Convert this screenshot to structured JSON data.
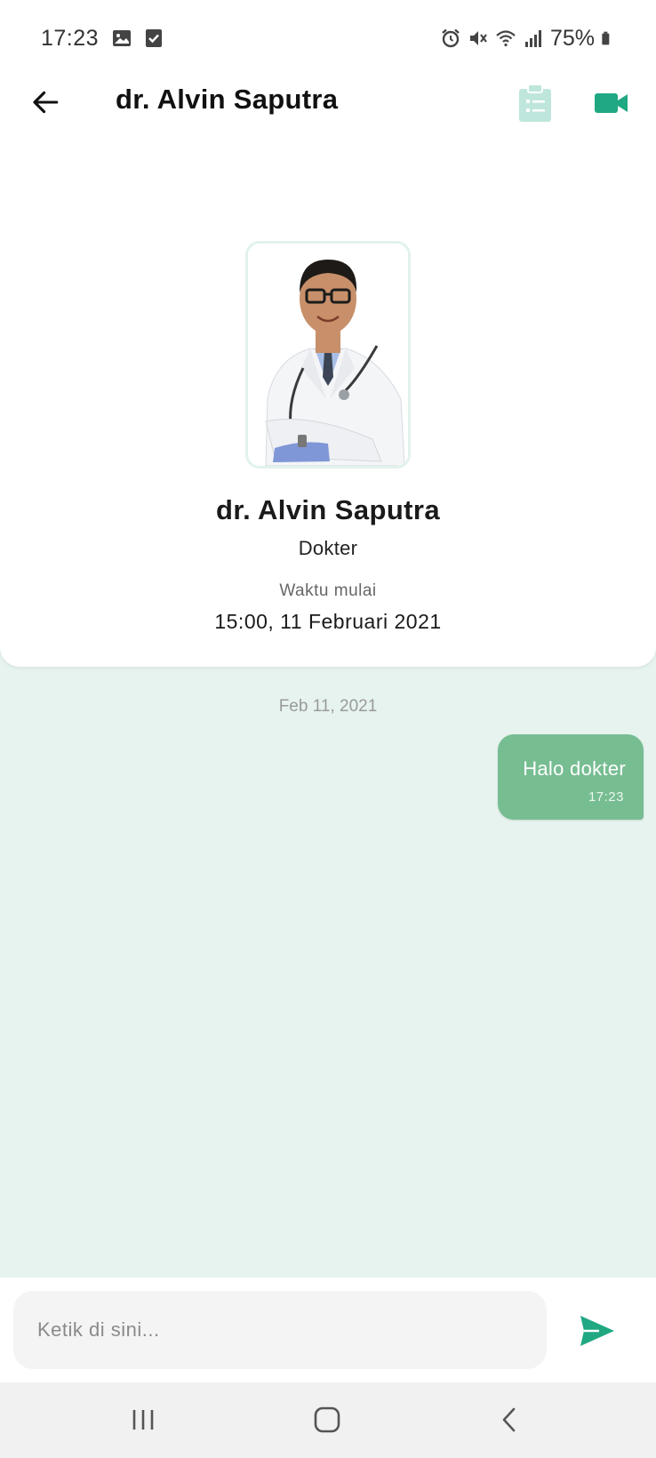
{
  "status_bar": {
    "time": "17:23",
    "battery": "75%",
    "left_icons": [
      "image-icon",
      "checkbox-icon"
    ],
    "right_icons": [
      "alarm-icon",
      "mute-icon",
      "wifi-icon",
      "signal-icon",
      "battery-icon"
    ]
  },
  "header": {
    "title": "dr. Alvin Saputra",
    "icons": [
      "back-arrow-icon",
      "clipboard-list-icon",
      "video-camera-icon"
    ]
  },
  "doctor": {
    "name": "dr. Alvin Saputra",
    "role": "Dokter",
    "start_label": "Waktu mulai",
    "start_value": "15:00, 11 Februari 2021"
  },
  "chat": {
    "date_divider": "Feb 11, 2021",
    "messages": [
      {
        "text": "Halo dokter",
        "time": "17:23",
        "from": "me"
      }
    ]
  },
  "input": {
    "placeholder": "Ketik di sini..."
  },
  "colors": {
    "accent": "#1fa882",
    "bubble": "#77bd92",
    "chat_background": "#e6f3ef",
    "clipboard_icon": "#bfe6dc"
  },
  "nav": {
    "icons": [
      "recent-apps-icon",
      "home-icon",
      "nav-back-icon"
    ]
  }
}
